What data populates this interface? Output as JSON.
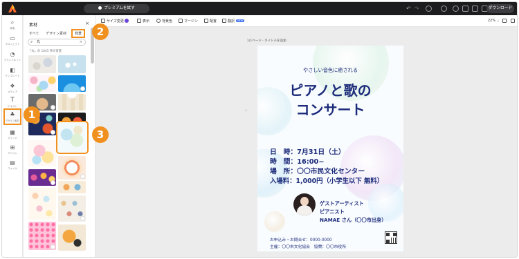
{
  "topbar": {
    "premium_label": "プレミアムを試す",
    "download_label": "ダウンロード"
  },
  "rail": {
    "items": [
      {
        "label": "検索",
        "icon": "search-icon"
      },
      {
        "label": "プロジェクト",
        "icon": "folder-icon"
      },
      {
        "label": "ブランドキット",
        "icon": "brand-kit-icon"
      },
      {
        "label": "テンプレート",
        "icon": "template-icon"
      },
      {
        "label": "メディア",
        "icon": "media-icon"
      },
      {
        "label": "テキスト",
        "icon": "text-icon"
      },
      {
        "label": "デザイン素材",
        "icon": "design-assets-icon"
      },
      {
        "label": "グリッド",
        "icon": "grid-icon"
      },
      {
        "label": "アドオン",
        "icon": "addon-icon"
      },
      {
        "label": "ファイル",
        "icon": "file-icon"
      }
    ]
  },
  "panel": {
    "title": "素材",
    "close_icon": "×",
    "tabs": [
      {
        "label": "すべて"
      },
      {
        "label": "デザイン素材"
      },
      {
        "label": "背景"
      }
    ],
    "search_value": "丸",
    "result_count": "「丸」の 1045 件の背景"
  },
  "canvas": {
    "toolbar": {
      "resize": "サイズ変更",
      "item2": "表示",
      "item3": "背景色",
      "item4": "マージン",
      "item5": "配置",
      "item6": "翻訳",
      "new_badge": "NEW",
      "zoom": "22%"
    },
    "page_label": "1/1ページ - タイトルを追加"
  },
  "poster": {
    "tagline": "やさしい音色に癒される",
    "title_line1": "ピアノと歌の",
    "title_line2": "コンサート",
    "date": "日　時：7月31日（土）",
    "time": "時　間：16:00~",
    "venue": "場　所：〇〇市民文化センター",
    "fee": "入場料：1,000円（小学生以下 無料）",
    "guest_label": "ゲストアーティスト",
    "guest_role": "ピアニスト",
    "guest_name": "NAMAE さん（〇〇市出身）",
    "contact": "お申込み・お問合せ：0000-0000",
    "host": "主催：〇〇市文化協会　協賛：〇〇市役所"
  },
  "callouts": [
    "1",
    "2",
    "3"
  ],
  "colors": {
    "accent": "#f0901e",
    "poster_text": "#1b2a7a",
    "topbar": "#1d1d1f"
  }
}
